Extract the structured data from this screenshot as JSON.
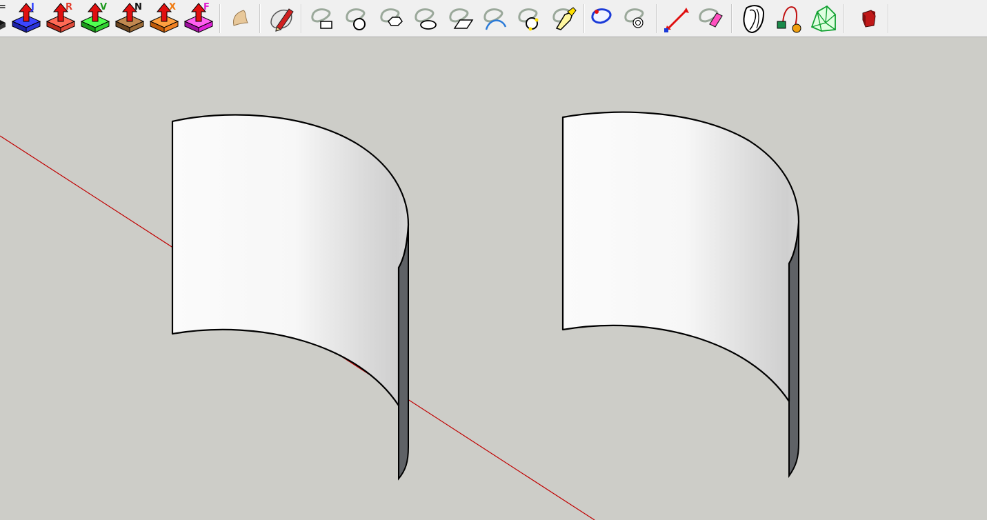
{
  "toolbar": {
    "push_buttons": [
      {
        "letter": "J",
        "color": "#2a3dff",
        "base_color": "#2a34d8"
      },
      {
        "letter": "R",
        "color": "#e23b2b",
        "base_color": "#e04a3a"
      },
      {
        "letter": "V",
        "color": "#1f9a1f",
        "base_color": "#30d030"
      },
      {
        "letter": "N",
        "color": "#111111",
        "base_color": "#9a6a36"
      },
      {
        "letter": "X",
        "color": "#f07a10",
        "base_color": "#f08020"
      },
      {
        "letter": "F",
        "color": "#e01ad0",
        "base_color": "#e020d8"
      }
    ],
    "colors": {
      "arrow": "#e01010",
      "accent_red_axis": "#c00000",
      "surface": "#f8f8f8",
      "back_face": "#5f6266",
      "viewport_bg": "#cdcdc8"
    }
  }
}
